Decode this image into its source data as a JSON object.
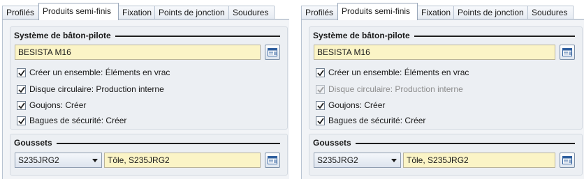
{
  "panels": [
    {
      "tabs": [
        {
          "label": "Profilés"
        },
        {
          "label": "Produits semi-finis"
        },
        {
          "label": "Fixation"
        },
        {
          "label": "Points de jonction"
        },
        {
          "label": "Soudures"
        }
      ],
      "active_tab": "Produits semi-finis",
      "pilot_group": {
        "title": "Système de bâton-pilote",
        "system_value": "BESISTA M16",
        "checks": [
          {
            "label": "Créer un ensemble: Éléments en vrac",
            "checked": true,
            "disabled": false
          },
          {
            "label": "Disque circulaire: Production interne",
            "checked": true,
            "disabled": false
          },
          {
            "label": "Goujons: Créer",
            "checked": true,
            "disabled": false
          },
          {
            "label": "Bagues de sécurité: Créer",
            "checked": true,
            "disabled": false
          }
        ]
      },
      "gusset_group": {
        "title": "Goussets",
        "material_value": "S235JRG2",
        "description_value": "Tôle, S235JRG2"
      }
    },
    {
      "tabs": [
        {
          "label": "Profilés"
        },
        {
          "label": "Produits semi-finis"
        },
        {
          "label": "Fixation"
        },
        {
          "label": "Points de jonction"
        },
        {
          "label": "Soudures"
        }
      ],
      "active_tab": "Produits semi-finis",
      "pilot_group": {
        "title": "Système de bâton-pilote",
        "system_value": "BESISTA M16",
        "checks": [
          {
            "label": "Créer un ensemble: Éléments en vrac",
            "checked": true,
            "disabled": false
          },
          {
            "label": "Disque circulaire: Production interne",
            "checked": true,
            "disabled": true
          },
          {
            "label": "Goujons: Créer",
            "checked": true,
            "disabled": false
          },
          {
            "label": "Bagues de sécurité: Créer",
            "checked": true,
            "disabled": false
          }
        ]
      },
      "gusset_group": {
        "title": "Goussets",
        "material_value": "S235JRG2",
        "description_value": "Tôle, S235JRG2"
      }
    }
  ]
}
